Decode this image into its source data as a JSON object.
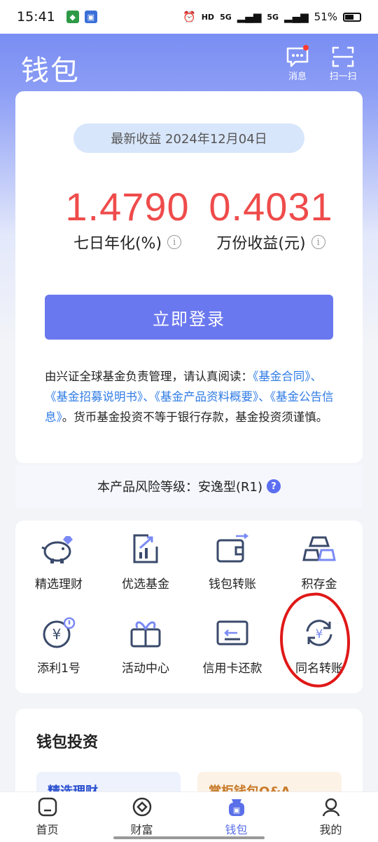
{
  "status_bar": {
    "time": "15:41",
    "network_1": "5G",
    "network_2": "5G",
    "battery": "51%"
  },
  "header": {
    "title": "钱包",
    "messages_label": "消息",
    "scan_label": "扫一扫"
  },
  "summary": {
    "date_label": "最新收益 2024年12月04日",
    "seven_day_value": "1.4790",
    "seven_day_label": "七日年化(%)",
    "per_10k_value": "0.4031",
    "per_10k_label": "万份收益(元)",
    "login_button": "立即登录",
    "disclaimer_prefix": "由兴证全球基金负责管理，请认真阅读：",
    "disclaimer_links": "《基金合同》、《基金招募说明书》、《基金产品资料概要》、《基金公告信息》",
    "disclaimer_suffix": "。货币基金投资不等于银行存款，基金投资须谨慎。"
  },
  "risk": {
    "text": "本产品风险等级：安逸型(R1)",
    "help_icon": "?"
  },
  "grid": {
    "items": [
      {
        "label": "精选理财",
        "icon": "piggy-bank-icon"
      },
      {
        "label": "优选基金",
        "icon": "chart-up-icon"
      },
      {
        "label": "钱包转账",
        "icon": "wallet-transfer-icon"
      },
      {
        "label": "积存金",
        "icon": "gold-bars-icon"
      },
      {
        "label": "添利1号",
        "icon": "yen-coin-icon"
      },
      {
        "label": "活动中心",
        "icon": "gift-icon"
      },
      {
        "label": "信用卡还款",
        "icon": "credit-card-icon"
      },
      {
        "label": "同名转账",
        "icon": "yen-cycle-icon"
      }
    ]
  },
  "invest": {
    "title": "钱包投资",
    "card_1": "精选理财",
    "card_2": "掌柜钱包Q&A"
  },
  "bottom_nav": {
    "items": [
      {
        "label": "首页"
      },
      {
        "label": "财富"
      },
      {
        "label": "钱包",
        "active": true
      },
      {
        "label": "我的"
      }
    ]
  },
  "colors": {
    "accent": "#6a78ef",
    "value_red": "#ef4b4b",
    "link_blue": "#2f7be5",
    "annotation_red": "#e01818"
  }
}
